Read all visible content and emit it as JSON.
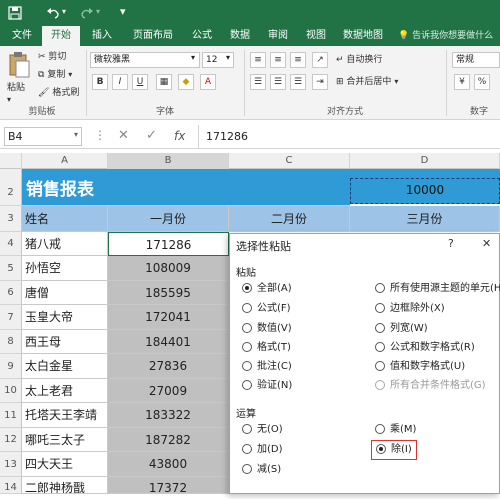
{
  "title_bar": {
    "save_icon": "save-icon",
    "undo_icon": "undo-icon",
    "redo_icon": "redo-icon"
  },
  "ribbon_tabs": [
    "文件",
    "开始",
    "插入",
    "页面布局",
    "公式",
    "数据",
    "审阅",
    "视图",
    "数据地图"
  ],
  "active_tab_index": 1,
  "tell_me": "告诉我你想要做什么",
  "ribbon": {
    "paste_label": "粘贴",
    "cut_label": "剪切",
    "copy_label": "复制",
    "format_painter_label": "格式刷",
    "clipboard_group": "剪贴板",
    "font_name": "微软雅黑",
    "font_size": "12",
    "bold": "B",
    "italic": "I",
    "underline": "U",
    "font_group": "字体",
    "wrap_text": "自动换行",
    "merge_center": "合并后居中",
    "alignment_group": "对齐方式",
    "number_format": "常规",
    "number_group": "数字"
  },
  "formula_bar": {
    "name_box": "B4",
    "fx": "fx",
    "value": "171286"
  },
  "columns": [
    "A",
    "B",
    "C",
    "D"
  ],
  "title_row": {
    "row_num": "2",
    "title": "销售报表",
    "d_value": "10000"
  },
  "header_row": {
    "row_num": "3",
    "a": "姓名",
    "b": "一月份",
    "c": "二月份",
    "d": "三月份"
  },
  "rows": [
    {
      "num": "4",
      "name": "猪八戒",
      "jan": "171286"
    },
    {
      "num": "5",
      "name": "孙悟空",
      "jan": "108009"
    },
    {
      "num": "6",
      "name": "唐僧",
      "jan": "185595"
    },
    {
      "num": "7",
      "name": "玉皇大帝",
      "jan": "172041"
    },
    {
      "num": "8",
      "name": "西王母",
      "jan": "184401"
    },
    {
      "num": "9",
      "name": "太白金星",
      "jan": "27836"
    },
    {
      "num": "10",
      "name": "太上老君",
      "jan": "27009"
    },
    {
      "num": "11",
      "name": "托塔天王李靖",
      "jan": "183322"
    },
    {
      "num": "12",
      "name": "哪吒三太子",
      "jan": "187282"
    },
    {
      "num": "13",
      "name": "四大天王",
      "jan": "43800"
    },
    {
      "num": "14",
      "name": "二郎神杨戬",
      "jan": "17372"
    }
  ],
  "dialog": {
    "title": "选择性粘贴",
    "help": "?",
    "close": "✕",
    "paste_section": "粘贴",
    "paste_left": [
      "全部(A)",
      "公式(F)",
      "数值(V)",
      "格式(T)",
      "批注(C)",
      "验证(N)"
    ],
    "paste_right": [
      "所有使用源主题的单元(H)",
      "边框除外(X)",
      "列宽(W)",
      "公式和数字格式(R)",
      "值和数字格式(U)",
      "所有合并条件格式(G)"
    ],
    "operation_section": "运算",
    "op_left": [
      "无(O)",
      "加(D)",
      "减(S)"
    ],
    "op_right": [
      "乘(M)",
      "除(I)"
    ]
  },
  "colors": {
    "excel_green": "#217346",
    "title_fill": "#2e9ad6",
    "header_fill": "#9dc3e6",
    "selection_fill": "#c0c0c0",
    "highlight_red": "#e03030"
  }
}
